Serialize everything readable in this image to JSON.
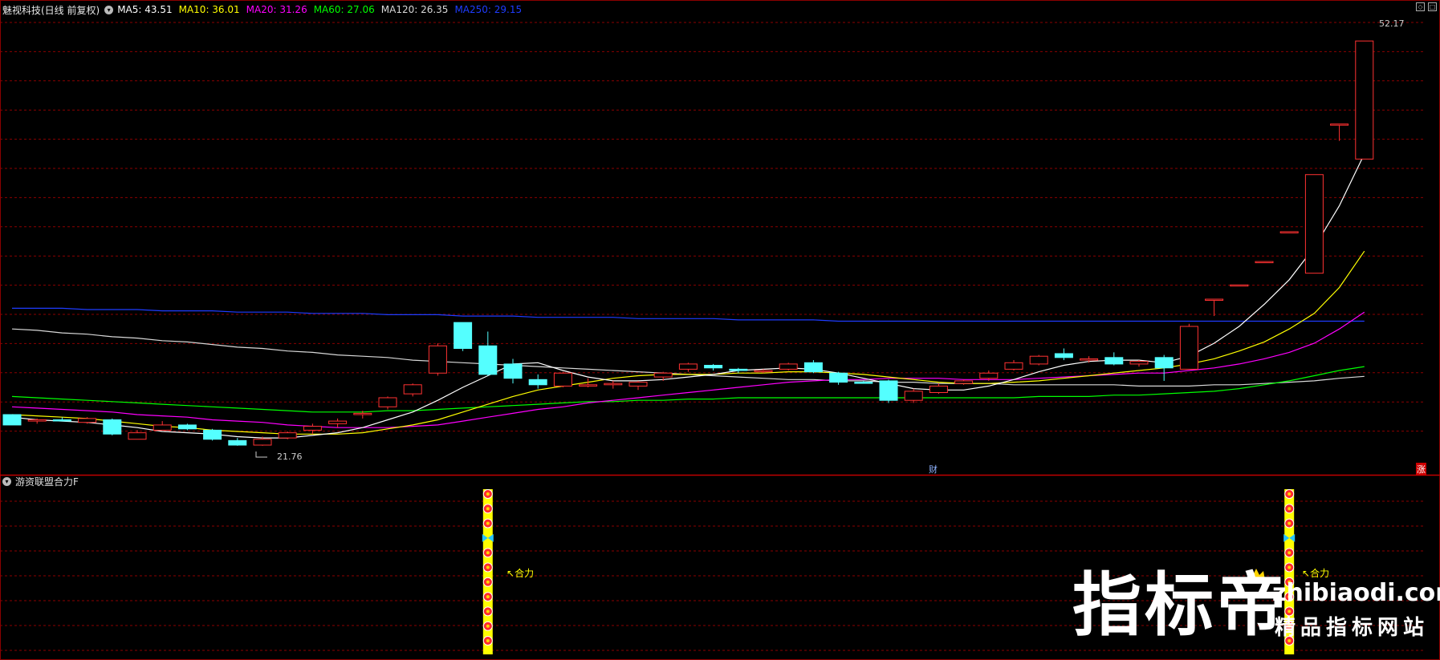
{
  "header": {
    "title": "魅视科技(日线 前复权)",
    "ma": [
      {
        "label": "MA5: 43.51",
        "color": "#ffffff"
      },
      {
        "label": "MA10: 36.01",
        "color": "#ffff00"
      },
      {
        "label": "MA20: 31.26",
        "color": "#ff00ff"
      },
      {
        "label": "MA60: 27.06",
        "color": "#00ff00"
      },
      {
        "label": "MA120: 26.35",
        "color": "#d8d8d8"
      },
      {
        "label": "MA250: 29.15",
        "color": "#1e3cff"
      }
    ]
  },
  "price_labels": {
    "high": "52.17",
    "low": "21.76"
  },
  "event_markers": {
    "cai": "财",
    "zhang": "涨"
  },
  "indicator": {
    "name": "游资联盟合力F",
    "signal_label": "合力"
  },
  "watermark": {
    "brand": "指标帝",
    "domain": "zhibiaodi.com",
    "slogan": "精品指标网站"
  },
  "colors": {
    "up": "#ff3232",
    "down": "#54ffff",
    "grid": "#8b0000",
    "signal": "#ffff00"
  },
  "chart_data": {
    "type": "candlestick",
    "price_range": [
      20,
      54
    ],
    "candles": [
      [
        23.4,
        23.4,
        22.6,
        22.6
      ],
      [
        22.9,
        23.1,
        22.7,
        23.0
      ],
      [
        23.0,
        23.2,
        22.9,
        22.95
      ],
      [
        22.8,
        23.2,
        22.7,
        23.1
      ],
      [
        23.0,
        23.1,
        21.8,
        21.9
      ],
      [
        21.5,
        22.2,
        21.5,
        22.0
      ],
      [
        22.2,
        22.9,
        22.2,
        22.6
      ],
      [
        22.6,
        22.7,
        22.2,
        22.3
      ],
      [
        22.2,
        22.3,
        21.4,
        21.5
      ],
      [
        21.4,
        21.6,
        21.0,
        21.05
      ],
      [
        21.05,
        21.7,
        21.0,
        21.5
      ],
      [
        21.6,
        22.1,
        21.5,
        22.0
      ],
      [
        22.2,
        22.7,
        21.9,
        22.5
      ],
      [
        22.7,
        23.1,
        22.4,
        22.9
      ],
      [
        23.4,
        23.7,
        23.1,
        23.5
      ],
      [
        24.0,
        24.8,
        23.8,
        24.7
      ],
      [
        25.0,
        25.8,
        24.8,
        25.7
      ],
      [
        26.6,
        28.9,
        26.4,
        28.7
      ],
      [
        30.5,
        30.5,
        28.3,
        28.5
      ],
      [
        28.7,
        29.8,
        26.4,
        26.5
      ],
      [
        27.3,
        27.7,
        25.8,
        26.2
      ],
      [
        26.1,
        26.5,
        25.4,
        25.7
      ],
      [
        25.6,
        26.7,
        25.5,
        26.6
      ],
      [
        25.6,
        26.2,
        25.5,
        25.7
      ],
      [
        25.7,
        26.0,
        25.4,
        25.8
      ],
      [
        25.6,
        26.0,
        25.3,
        25.9
      ],
      [
        26.3,
        26.7,
        26.0,
        26.6
      ],
      [
        26.9,
        27.4,
        26.7,
        27.3
      ],
      [
        27.2,
        27.3,
        26.8,
        27.0
      ],
      [
        26.9,
        27.0,
        26.6,
        26.8
      ],
      [
        26.7,
        26.9,
        26.6,
        26.8
      ],
      [
        26.9,
        27.4,
        26.8,
        27.3
      ],
      [
        27.4,
        27.6,
        26.6,
        26.7
      ],
      [
        26.6,
        26.7,
        25.7,
        25.9
      ],
      [
        25.9,
        26.0,
        25.8,
        25.85
      ],
      [
        26.0,
        26.1,
        24.3,
        24.5
      ],
      [
        24.5,
        25.4,
        24.3,
        25.2
      ],
      [
        25.1,
        25.8,
        25.0,
        25.6
      ],
      [
        25.8,
        26.1,
        25.7,
        26.0
      ],
      [
        26.2,
        26.8,
        26.0,
        26.6
      ],
      [
        26.9,
        27.6,
        26.8,
        27.4
      ],
      [
        27.3,
        28.0,
        27.2,
        27.9
      ],
      [
        28.1,
        28.5,
        27.6,
        27.8
      ],
      [
        27.6,
        27.9,
        27.4,
        27.7
      ],
      [
        27.8,
        28.2,
        27.2,
        27.3
      ],
      [
        27.3,
        27.6,
        27.1,
        27.5
      ],
      [
        27.8,
        28.0,
        26.0,
        27.0
      ],
      [
        26.9,
        30.4,
        26.9,
        30.2
      ],
      [
        32.3,
        32.3,
        31.0,
        32.3
      ],
      [
        33.4,
        33.4,
        33.4,
        33.4
      ],
      [
        35.2,
        35.2,
        35.2,
        35.2
      ],
      [
        37.5,
        37.5,
        37.5,
        37.5
      ],
      [
        34.3,
        41.9,
        34.3,
        41.9
      ],
      [
        45.8,
        45.8,
        44.5,
        45.8
      ],
      [
        43.1,
        52.2,
        43.1,
        52.2
      ]
    ],
    "ma5": [
      23.2,
      23.0,
      22.9,
      22.8,
      22.6,
      22.4,
      22.1,
      22.0,
      21.9,
      21.7,
      21.6,
      21.6,
      21.8,
      22.0,
      22.4,
      23.0,
      23.6,
      24.5,
      25.5,
      26.4,
      27.3,
      27.4,
      26.8,
      26.3,
      26.0,
      26.0,
      26.1,
      26.3,
      26.5,
      26.8,
      26.9,
      27.0,
      26.9,
      26.6,
      26.2,
      25.8,
      25.4,
      25.3,
      25.3,
      25.6,
      26.1,
      26.7,
      27.2,
      27.5,
      27.6,
      27.6,
      27.4,
      27.9,
      28.9,
      30.2,
      31.9,
      33.8,
      36.3,
      39.5,
      43.5
    ],
    "ma10": [
      23.4,
      23.3,
      23.2,
      23.1,
      22.9,
      22.7,
      22.5,
      22.4,
      22.2,
      22.1,
      22.0,
      21.9,
      21.9,
      21.9,
      22.0,
      22.3,
      22.6,
      23.0,
      23.6,
      24.2,
      24.8,
      25.3,
      25.6,
      25.9,
      26.2,
      26.4,
      26.5,
      26.5,
      26.5,
      26.6,
      26.6,
      26.7,
      26.7,
      26.6,
      26.5,
      26.3,
      26.1,
      25.9,
      25.8,
      25.8,
      25.9,
      26.0,
      26.2,
      26.4,
      26.6,
      26.8,
      27.0,
      27.3,
      27.7,
      28.3,
      29.0,
      30.0,
      31.2,
      33.2,
      36.0
    ],
    "ma20": [
      24.0,
      23.9,
      23.8,
      23.7,
      23.6,
      23.4,
      23.3,
      23.2,
      23.0,
      22.9,
      22.8,
      22.6,
      22.5,
      22.4,
      22.4,
      22.4,
      22.5,
      22.6,
      22.9,
      23.2,
      23.5,
      23.8,
      24.0,
      24.3,
      24.5,
      24.7,
      24.9,
      25.1,
      25.3,
      25.5,
      25.7,
      25.9,
      26.0,
      26.1,
      26.1,
      26.2,
      26.2,
      26.2,
      26.1,
      26.1,
      26.1,
      26.2,
      26.3,
      26.4,
      26.5,
      26.6,
      26.6,
      26.8,
      27.0,
      27.3,
      27.7,
      28.2,
      28.9,
      30.0,
      31.3
    ],
    "ma60": [
      24.8,
      24.7,
      24.6,
      24.5,
      24.4,
      24.3,
      24.2,
      24.1,
      24.0,
      23.9,
      23.8,
      23.7,
      23.6,
      23.6,
      23.6,
      23.7,
      23.7,
      23.8,
      23.9,
      24.0,
      24.1,
      24.2,
      24.3,
      24.4,
      24.4,
      24.5,
      24.5,
      24.6,
      24.6,
      24.7,
      24.7,
      24.7,
      24.7,
      24.7,
      24.7,
      24.7,
      24.7,
      24.7,
      24.7,
      24.7,
      24.7,
      24.8,
      24.8,
      24.8,
      24.9,
      24.9,
      25.0,
      25.1,
      25.2,
      25.4,
      25.7,
      26.0,
      26.4,
      26.8,
      27.1
    ],
    "ma120": [
      30.0,
      29.9,
      29.7,
      29.6,
      29.4,
      29.3,
      29.1,
      29.0,
      28.8,
      28.6,
      28.5,
      28.3,
      28.2,
      28.0,
      27.9,
      27.8,
      27.6,
      27.5,
      27.4,
      27.3,
      27.2,
      27.1,
      27.0,
      26.9,
      26.8,
      26.7,
      26.6,
      26.5,
      26.4,
      26.3,
      26.2,
      26.1,
      26.1,
      26.0,
      26.0,
      25.9,
      25.9,
      25.8,
      25.8,
      25.8,
      25.7,
      25.7,
      25.7,
      25.7,
      25.7,
      25.6,
      25.6,
      25.6,
      25.7,
      25.7,
      25.8,
      25.9,
      26.0,
      26.2,
      26.35
    ],
    "ma250": [
      31.6,
      31.6,
      31.6,
      31.5,
      31.5,
      31.5,
      31.4,
      31.4,
      31.4,
      31.3,
      31.3,
      31.3,
      31.2,
      31.2,
      31.2,
      31.1,
      31.1,
      31.1,
      31.0,
      31.0,
      31.0,
      30.9,
      30.9,
      30.9,
      30.9,
      30.8,
      30.8,
      30.8,
      30.8,
      30.7,
      30.7,
      30.7,
      30.7,
      30.6,
      30.6,
      30.6,
      30.6,
      30.6,
      30.6,
      30.6,
      30.6,
      30.6,
      30.6,
      30.6,
      30.6,
      30.6,
      30.6,
      30.6,
      30.6,
      30.6,
      30.6,
      30.6,
      30.6,
      30.6,
      30.6
    ],
    "signal_candles": [
      19,
      51
    ]
  }
}
